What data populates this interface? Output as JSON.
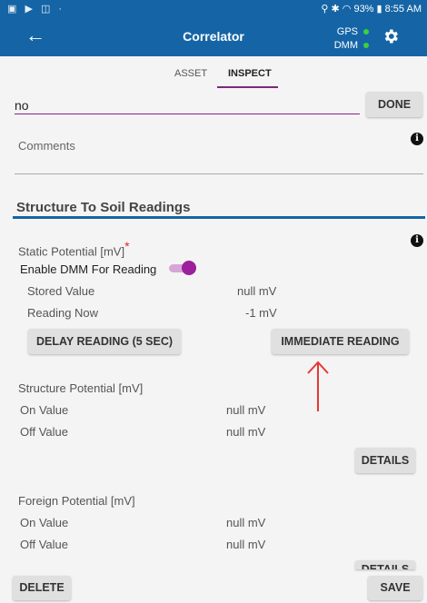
{
  "status_bar": {
    "left_icons": "▣ ▶ ◫ ·",
    "right_text": "⚲ ✱ ◠ 93% ▮ 8:55 AM"
  },
  "app_bar": {
    "back_icon": "←",
    "title": "Correlator",
    "gps_label": "GPS",
    "dmm_label": "DMM",
    "indicator_color": "#3cd13c",
    "settings_icon": "gear"
  },
  "tabs": [
    {
      "label": "ASSET",
      "active": false
    },
    {
      "label": "INSPECT",
      "active": true
    }
  ],
  "search": {
    "value": "no",
    "done_label": "DONE"
  },
  "comments": {
    "label": "Comments"
  },
  "section": {
    "title": "Structure To Soil Readings"
  },
  "static_potential": {
    "label": "Static Potential [mV]",
    "required_mark": "*",
    "enable_label": "Enable DMM For Reading",
    "stored_label": "Stored Value",
    "stored_value": "null mV",
    "reading_now_label": "Reading Now",
    "reading_now_value": "-1 mV",
    "delay_button": "DELAY READING (5 SEC)",
    "immediate_button": "IMMEDIATE READING"
  },
  "structure_potential": {
    "label": "Structure Potential [mV]",
    "on_label": "On Value",
    "on_value": "null mV",
    "off_label": "Off Value",
    "off_value": "null mV",
    "details_label": "DETAILS"
  },
  "foreign_potential": {
    "label": "Foreign Potential [mV]",
    "on_label": "On Value",
    "on_value": "null mV",
    "off_label": "Off Value",
    "off_value": "null mV",
    "details_label": "DETAILS"
  },
  "footer": {
    "delete_label": "DELETE",
    "save_label": "SAVE"
  },
  "colors": {
    "primary": "#1565a6",
    "accent": "#8b1f8b",
    "annotation_arrow": "#e53935"
  }
}
